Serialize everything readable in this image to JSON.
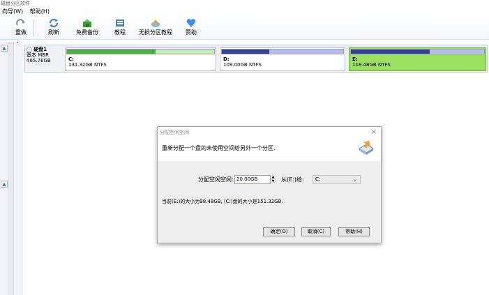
{
  "window": {
    "title": "磁盘分区软件"
  },
  "menu": {
    "items": [
      "向导(W)",
      "帮助(H)"
    ]
  },
  "toolbar": {
    "buttons": [
      {
        "label": "重做",
        "icon": "redo-icon"
      },
      {
        "label": "刷新",
        "icon": "refresh-icon"
      },
      {
        "label": "免费备份",
        "icon": "backup-icon"
      },
      {
        "label": "教程",
        "icon": "tutorial-icon"
      },
      {
        "label": "无损分区教程",
        "icon": "partition-tutorial-icon"
      },
      {
        "label": "赞助",
        "icon": "heart-icon"
      }
    ]
  },
  "disk": {
    "name": "硬盘1",
    "type": "基本 MBR",
    "size": "465.76GB",
    "partitions": [
      {
        "letter": "C:",
        "info": "131.32GB NTFS",
        "used_fraction": 0.6,
        "fill_color": "#4caf3c",
        "rest_color": "#c6ecb4"
      },
      {
        "letter": "D:",
        "info": "109.00GB NTFS",
        "used_fraction": 0.39,
        "fill_color": "#3a3e8e",
        "rest_color": "#b9bce8"
      },
      {
        "letter": "E:",
        "info": "118.48GB NTFS",
        "used_fraction": 0.59,
        "fill_color": "#3a3e8e",
        "rest_color": "#b9bce8",
        "selected": true
      }
    ]
  },
  "dialog": {
    "title": "分配空闲空间",
    "close": "×",
    "description": "重新分配一个盘的未使用空间给另外一个分区.",
    "space_label": "分配空闲空间:",
    "space_value": "20.00GB",
    "from_label": "从(E:)给:",
    "target_value": "C:",
    "info_text": "当前(E:)的大小为98.48GB, (C:)盘的大小是151.32GB.",
    "ok": "确定(O)",
    "cancel": "取消(C)",
    "help": "帮助(H)"
  }
}
